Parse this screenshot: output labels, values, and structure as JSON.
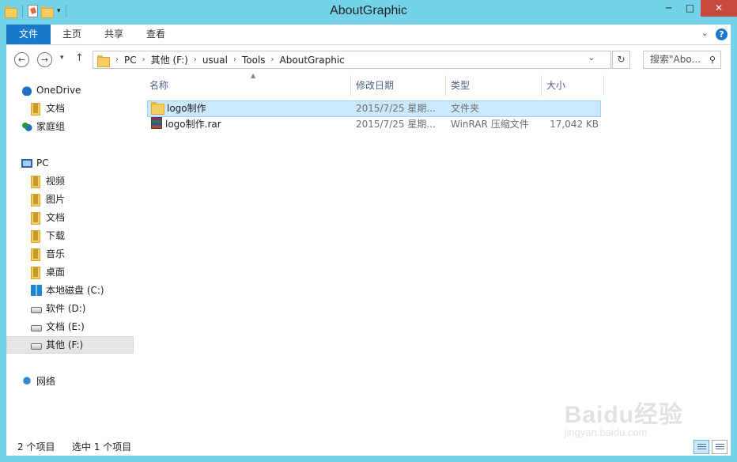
{
  "window": {
    "title": "AboutGraphic"
  },
  "ribbon": {
    "tabs": [
      "文件",
      "主页",
      "共享",
      "查看"
    ],
    "help": "?"
  },
  "address": {
    "segments": [
      "PC",
      "其他 (F:)",
      "usual",
      "Tools",
      "AboutGraphic"
    ]
  },
  "search": {
    "placeholder": "搜索\"Abo..."
  },
  "nav": {
    "items": [
      {
        "label": "OneDrive",
        "icon": "onedrive-icon"
      },
      {
        "label": "文档",
        "icon": "folder-icon"
      },
      {
        "label": "家庭组",
        "icon": "homegroup-icon"
      },
      {
        "label": "PC",
        "icon": "computer-icon"
      },
      {
        "label": "视频",
        "icon": "videos-folder-icon"
      },
      {
        "label": "图片",
        "icon": "pictures-folder-icon"
      },
      {
        "label": "文档",
        "icon": "documents-folder-icon"
      },
      {
        "label": "下载",
        "icon": "downloads-folder-icon"
      },
      {
        "label": "音乐",
        "icon": "music-folder-icon"
      },
      {
        "label": "桌面",
        "icon": "desktop-folder-icon"
      },
      {
        "label": "本地磁盘 (C:)",
        "icon": "windows-drive-icon"
      },
      {
        "label": "软件 (D:)",
        "icon": "drive-icon"
      },
      {
        "label": "文档 (E:)",
        "icon": "drive-icon"
      },
      {
        "label": "其他 (F:)",
        "icon": "drive-icon",
        "selected": true
      },
      {
        "label": "网络",
        "icon": "network-icon"
      }
    ]
  },
  "columns": [
    "名称",
    "修改日期",
    "类型",
    "大小"
  ],
  "files": [
    {
      "name": "logo制作",
      "date": "2015/7/25 星期...",
      "type": "文件夹",
      "size": "",
      "icon": "folder-icon",
      "selected": true
    },
    {
      "name": "logo制作.rar",
      "date": "2015/7/25 星期...",
      "type": "WinRAR 压缩文件",
      "size": "17,042 KB",
      "icon": "rar-archive-icon",
      "selected": false
    }
  ],
  "status": {
    "count": "2 个项目",
    "selection": "选中 1 个项目"
  },
  "watermark": {
    "main": "Baidu经验",
    "sub": "jingyan.baidu.com"
  }
}
